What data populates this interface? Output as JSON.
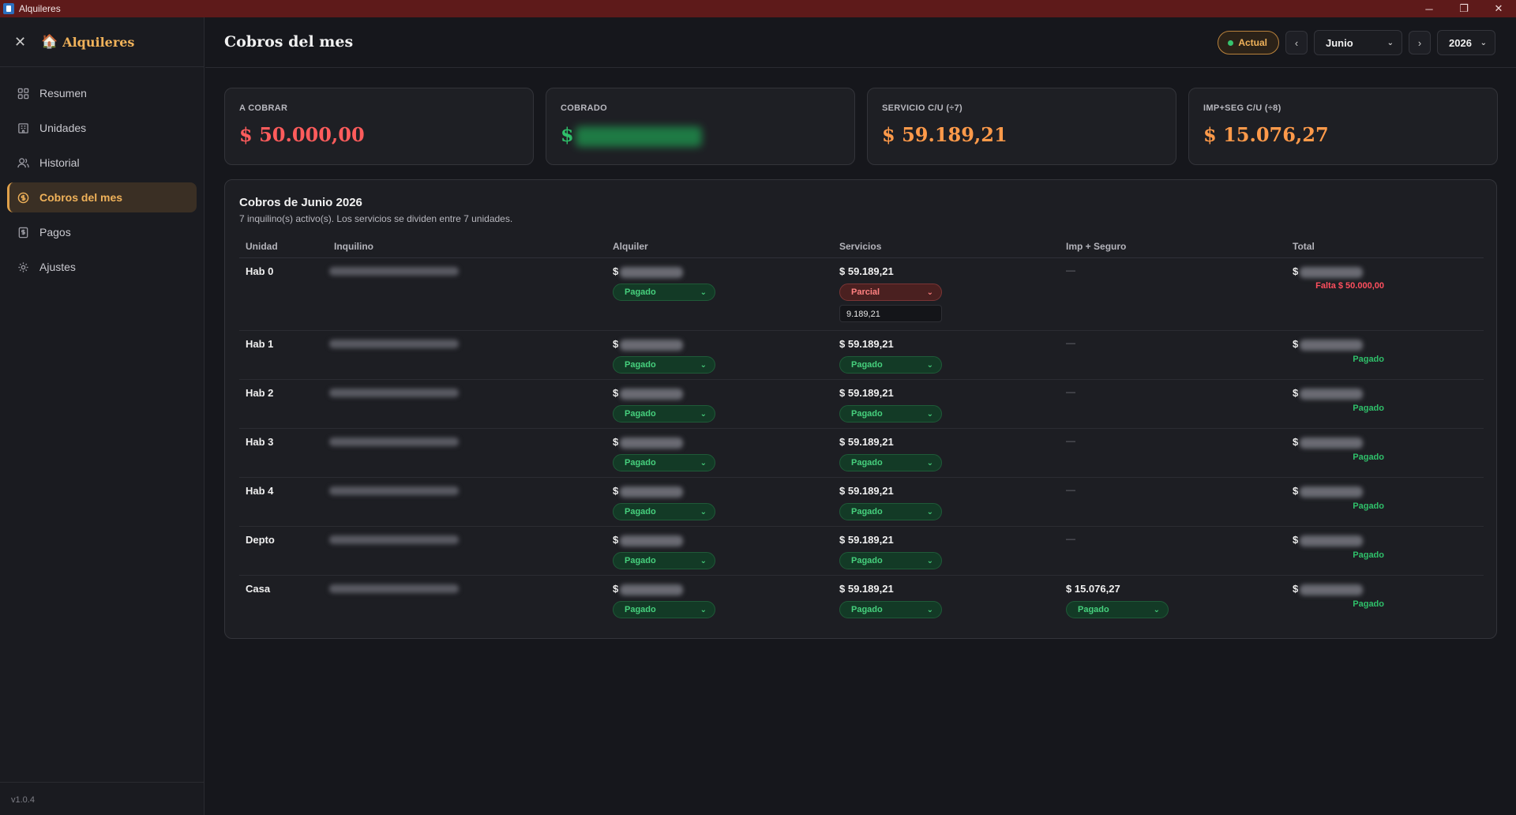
{
  "window": {
    "title": "Alquileres",
    "minimize": "─",
    "restore": "❐",
    "close": "✕"
  },
  "sidebar": {
    "close_glyph": "✕",
    "brand": "Alquileres",
    "brand_icon": "🏠",
    "items": [
      {
        "label": "Resumen",
        "icon": "grid-icon"
      },
      {
        "label": "Unidades",
        "icon": "building-icon"
      },
      {
        "label": "Historial",
        "icon": "users-icon"
      },
      {
        "label": "Cobros del mes",
        "icon": "dollar-circle-icon",
        "active": true
      },
      {
        "label": "Pagos",
        "icon": "dollar-doc-icon"
      },
      {
        "label": "Ajustes",
        "icon": "gear-icon"
      }
    ],
    "version": "v1.0.4"
  },
  "header": {
    "title": "Cobros del mes",
    "actual_label": "Actual",
    "prev_glyph": "‹",
    "next_glyph": "›",
    "month": "Junio",
    "year": "2026",
    "chevron": "⌄"
  },
  "cards": [
    {
      "label": "A COBRAR",
      "currency": "$",
      "value": "50.000,00",
      "color": "#ff5c5c"
    },
    {
      "label": "COBRADO",
      "currency": "$",
      "value": "",
      "color": "#2fbf6a",
      "obscured": true
    },
    {
      "label": "SERVICIO C/U (÷7)",
      "currency": "$",
      "value": "59.189,21",
      "color": "#ff9a4a"
    },
    {
      "label": "IMP+SEG C/U (÷8)",
      "currency": "$",
      "value": "15.076,27",
      "color": "#ff9a4a"
    }
  ],
  "table": {
    "title": "Cobros de Junio 2026",
    "subtitle": "7 inquilino(s) activo(s). Los servicios se dividen entre 7 unidades.",
    "columns": [
      "Unidad",
      "Inquilino",
      "Alquiler",
      "Servicios",
      "Imp + Seguro",
      "Total"
    ],
    "currency": "$",
    "rows": [
      {
        "unit": "Hab 0",
        "rent_status": "Pagado",
        "services": "$ 59.189,21",
        "services_status": "Parcial",
        "services_paid": "9.189,21",
        "imp": "—",
        "imp_status": "",
        "total_status": "Falta $ 50.000,00"
      },
      {
        "unit": "Hab 1",
        "rent_status": "Pagado",
        "services": "$ 59.189,21",
        "services_status": "Pagado",
        "imp": "—",
        "imp_status": "",
        "total_status": "Pagado"
      },
      {
        "unit": "Hab 2",
        "rent_status": "Pagado",
        "services": "$ 59.189,21",
        "services_status": "Pagado",
        "imp": "—",
        "imp_status": "",
        "total_status": "Pagado"
      },
      {
        "unit": "Hab 3",
        "rent_status": "Pagado",
        "services": "$ 59.189,21",
        "services_status": "Pagado",
        "imp": "—",
        "imp_status": "",
        "total_status": "Pagado"
      },
      {
        "unit": "Hab 4",
        "rent_status": "Pagado",
        "services": "$ 59.189,21",
        "services_status": "Pagado",
        "imp": "—",
        "imp_status": "",
        "total_status": "Pagado"
      },
      {
        "unit": "Depto",
        "rent_status": "Pagado",
        "services": "$ 59.189,21",
        "services_status": "Pagado",
        "imp": "—",
        "imp_status": "",
        "total_status": "Pagado"
      },
      {
        "unit": "Casa",
        "rent_status": "Pagado",
        "services": "$ 59.189,21",
        "services_status": "Pagado",
        "imp": "$ 15.076,27",
        "imp_status": "Pagado",
        "total_status": "Pagado"
      }
    ]
  },
  "colors": {
    "accent": "#f0b25a",
    "titlebar": "#5e1a1a",
    "paid": "#2fc06a",
    "due": "#ff4f5e"
  }
}
